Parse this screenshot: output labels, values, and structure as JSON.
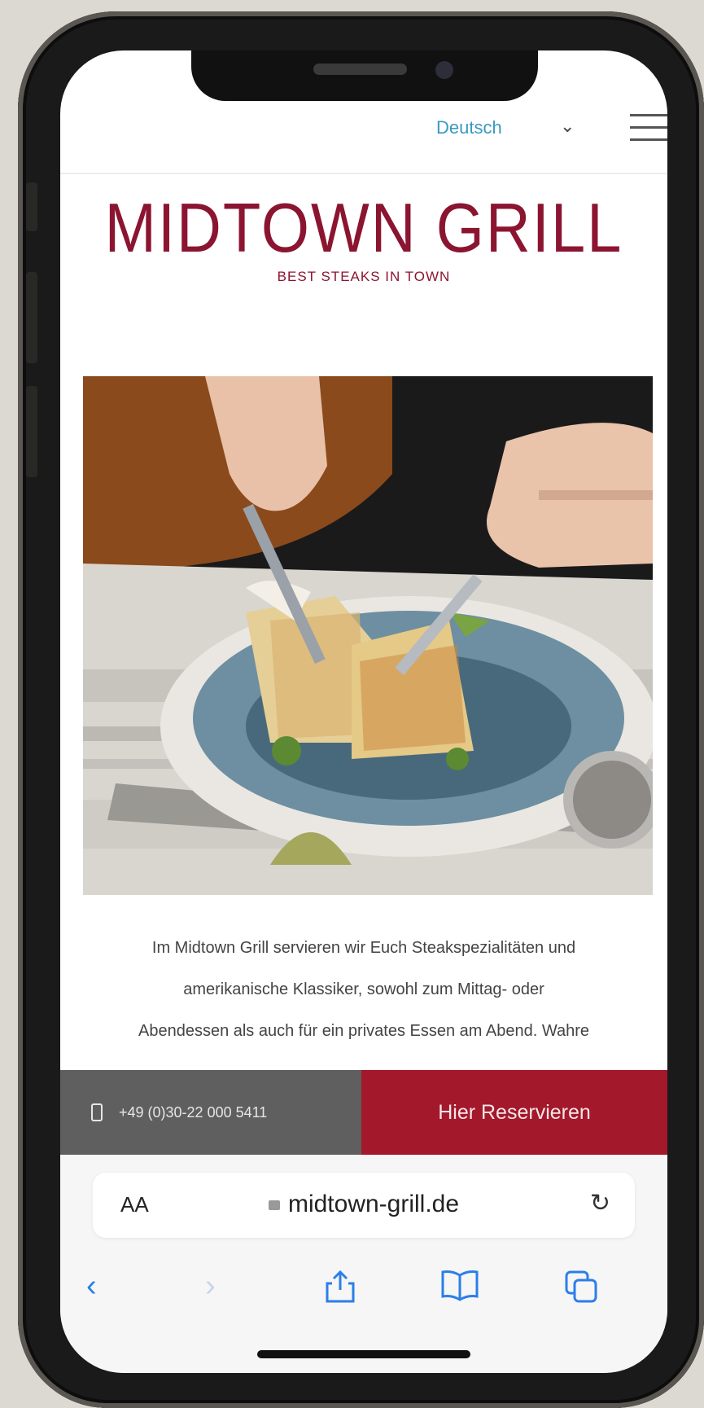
{
  "header": {
    "language": "Deutsch"
  },
  "brand": {
    "title": "MIDTOWN GRILL",
    "tagline": "BEST STEAKS IN TOWN"
  },
  "intro": {
    "line1": "Im Midtown Grill servieren wir Euch Steakspezialitäten und",
    "line2": "amerikanische Klassiker, sowohl zum Mittag- oder",
    "line3": "Abendessen als auch für ein privates Essen am Abend. Wahre"
  },
  "cta": {
    "phone": "+49 (0)30-22 000 5411",
    "reserve": "Hier Reservieren"
  },
  "browser": {
    "text_size": "AA",
    "url": "midtown-grill.de"
  },
  "colors": {
    "brand_red": "#a3182b",
    "link_blue": "#3a9ac0",
    "toolbar_blue": "#2b7fe8"
  }
}
